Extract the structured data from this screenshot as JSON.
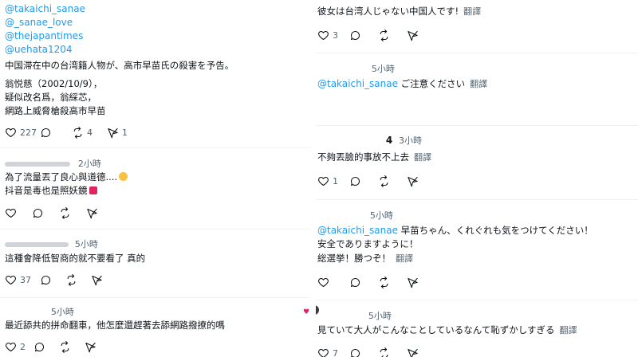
{
  "left": {
    "mentions": [
      "@takaichi_sanae",
      "@_sanae_love",
      "@thejapantimes",
      "@uehata1204"
    ],
    "post1": {
      "line1": "中国滞在中の台湾籍人物が、高市早苗氏の殺害を予告。",
      "line2": "翁悦慈（2002/10/9），",
      "line3": "疑似改名爲，翁綵芯，",
      "line4": "網路上威脅槍殺高市早苗",
      "replies": "227",
      "reposts": "4",
      "views": "1"
    },
    "post2": {
      "time": "2小時",
      "line1": "為了流量丟了良心與道德....",
      "line2": "抖音是毒也是照妖鏡",
      "replies": "",
      "reposts": ""
    },
    "post3": {
      "time": "5小時",
      "time_visible": "5小時",
      "line1": "這種會降低智商的就不要看了 真的",
      "replies": "37"
    },
    "post4": {
      "time": "5小時",
      "line1": "最近舔共的拼命翻車，他怎麼還趕著去舔網路撥撩的嗎",
      "replies": "2"
    }
  },
  "right": {
    "post1": {
      "line1": "彼女は台湾人じゃない中国人です!",
      "translate": "翻譯",
      "replies": "3"
    },
    "post2": {
      "time": "5小時",
      "mention": "@takaichi_sanae",
      "text": "ご注意ください",
      "translate": "翻譯"
    },
    "post3": {
      "name_fragment": "4",
      "time": "3小時",
      "line1": "不夠丟臉的事放不上去",
      "translate": "翻譯",
      "replies": "1"
    },
    "post4": {
      "time": "5小時",
      "mention": "@takaichi_sanae",
      "line1": "早苗ちゃん、くれぐれも気をつけてください！",
      "line2": "安全でありますように！",
      "line3": "総選挙！勝つぞ！",
      "translate": "翻譯"
    },
    "post5": {
      "time": "5小時",
      "line1": "見ていて大人がこんなことしているなんて恥ずかしすぎる",
      "translate": "翻譯",
      "replies": "7"
    }
  },
  "colors": {
    "link": "#1d9bf0",
    "text": "#0f1419",
    "muted": "#536471",
    "divider": "#eff3f4"
  }
}
